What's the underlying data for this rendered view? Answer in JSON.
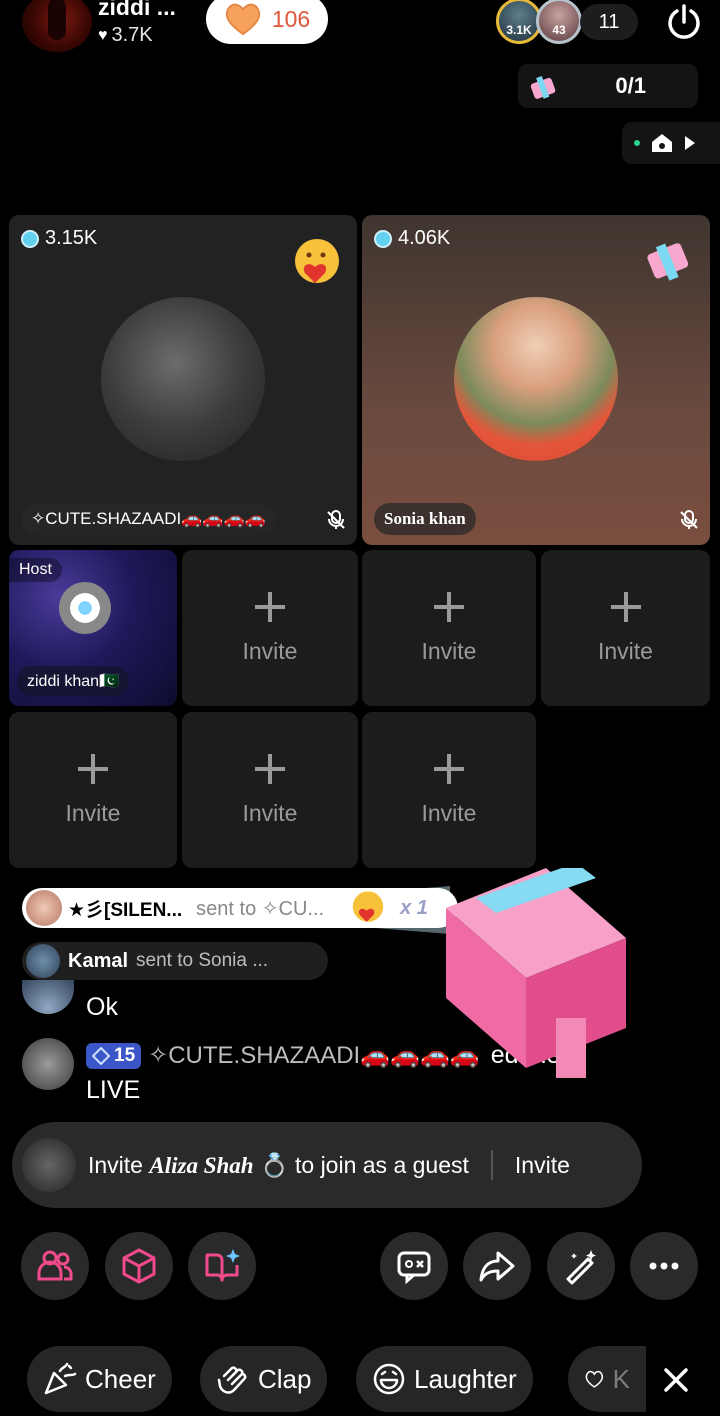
{
  "header": {
    "host_name": "ziddi ...",
    "host_likes": "3.7K",
    "like_count": "106",
    "viewers": [
      {
        "label": "3.1K",
        "color": "#e9b93a"
      },
      {
        "label": "43",
        "color": "#b7c3cc"
      }
    ],
    "viewer_count": "11",
    "power_icon": "power-icon"
  },
  "gift_goal": {
    "progress": "0/1",
    "icon": "gift-box-icon"
  },
  "mini_bar": {
    "icons": [
      "status-dot-icon",
      "home-icon",
      "play-icon"
    ]
  },
  "guests": [
    {
      "coins": "3.15K",
      "name": "✧CUTE.SHAZAADI🚗🚗🚗🚗",
      "muted": true,
      "sticker": "hugging-heart-emoji-icon"
    },
    {
      "coins": "4.06K",
      "name": "Sonia khan",
      "muted": true,
      "sticker": "gift-box-icon"
    }
  ],
  "host_slot": {
    "label": "Host",
    "name": "ziddi khan🇵🇰"
  },
  "invite_slots": [
    "Invite",
    "Invite",
    "Invite",
    "Invite",
    "Invite",
    "Invite"
  ],
  "feed": {
    "gift1": {
      "name": "★彡[SILEN...",
      "sent": "sent to ✧CU...",
      "count": "x 1"
    },
    "gift2": {
      "name": "Kamal",
      "sent": "sent to Sonia ..."
    },
    "comment1": {
      "text": "Ok"
    },
    "comment2": {
      "level": "15",
      "name": "✧CUTE.SHAZAADI🚗🚗🚗🚗",
      "text_tail": "ed the",
      "text2": "LIVE"
    }
  },
  "invite_banner": {
    "prefix": "Invite ",
    "name": "Aliza Shah",
    "ring": "💍",
    "suffix": " to join as a guest",
    "button": "Invite"
  },
  "actions": [
    "people-icon",
    "cube-icon",
    "book-sparkle-icon",
    "comment-box-icon",
    "share-icon",
    "magic-wand-icon",
    "more-icon"
  ],
  "reactions": [
    {
      "label": "Cheer",
      "icon": "party-popper-icon"
    },
    {
      "label": "Clap",
      "icon": "clap-icon"
    },
    {
      "label": "Laughter",
      "icon": "laugh-icon"
    },
    {
      "label": "K",
      "icon": "heart-outline-icon"
    }
  ],
  "colors": {
    "like": "#e0563b",
    "coin": "#62d0ee",
    "level_badge": "#3a56c9",
    "accent_pink": "#f04a8c"
  }
}
